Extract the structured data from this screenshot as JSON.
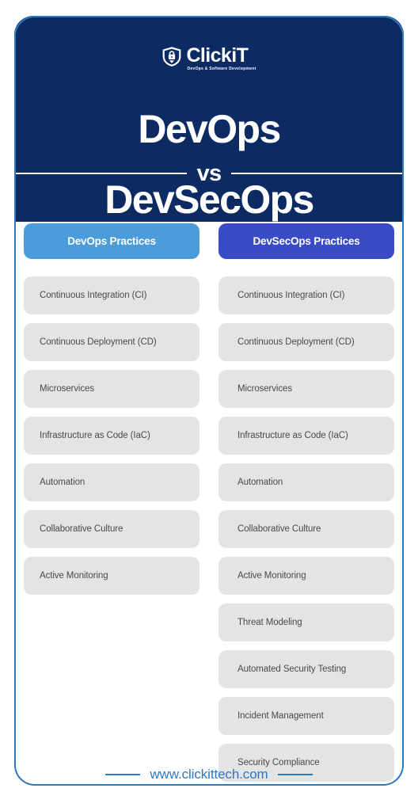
{
  "brand": {
    "logo_icon": "shield-lock-icon",
    "name": "ClickiT",
    "tagline": "DevOps & Software Development"
  },
  "hero": {
    "title_top": "DevOps",
    "vs_label": "vs",
    "title_bottom": "DevSecOps",
    "background_color": "#0C2B63"
  },
  "columns": [
    {
      "key": "devops",
      "header": "DevOps Practices",
      "header_color": "#4A9CDB",
      "items": [
        "Continuous Integration (CI)",
        "Continuous Deployment (CD)",
        "Microservices",
        "Infrastructure as Code (IaC)",
        "Automation",
        "Collaborative Culture",
        "Active Monitoring"
      ]
    },
    {
      "key": "devsecops",
      "header": "DevSecOps Practices",
      "header_color": "#3A4BC8",
      "items": [
        "Continuous Integration (CI)",
        "Continuous Deployment (CD)",
        "Microservices",
        "Infrastructure as Code (IaC)",
        "Automation",
        "Collaborative Culture",
        "Active Monitoring",
        "Threat Modeling",
        "Automated Security Testing",
        "Incident Management",
        "Security Compliance"
      ]
    }
  ],
  "footer": {
    "url": "www.clickittech.com",
    "accent_color": "#2E78C0"
  }
}
